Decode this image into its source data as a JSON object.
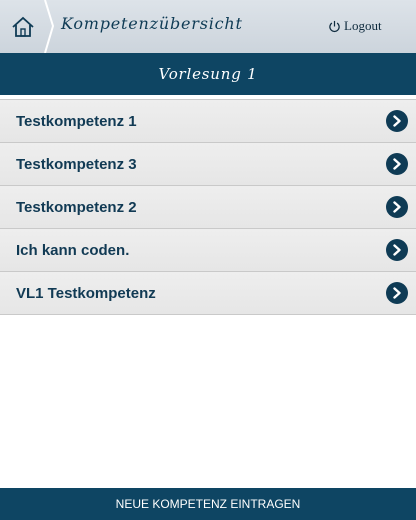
{
  "header": {
    "title": "Kompetenzübersicht",
    "logout_label": "Logout",
    "home_icon": "home-icon",
    "logout_icon": "power-icon"
  },
  "subheader": {
    "title": "Vorlesung 1"
  },
  "competencies": [
    {
      "label": "Testkompetenz 1"
    },
    {
      "label": "Testkompetenz 3"
    },
    {
      "label": "Testkompetenz 2"
    },
    {
      "label": "Ich kann coden."
    },
    {
      "label": "VL1 Testkompetenz"
    }
  ],
  "footer": {
    "new_button_label": "NEUE KOMPETENZ EINTRAGEN"
  },
  "colors": {
    "accent": "#0e4563",
    "topbar": "#d3dbe2",
    "list_bg": "#eaeaea"
  }
}
